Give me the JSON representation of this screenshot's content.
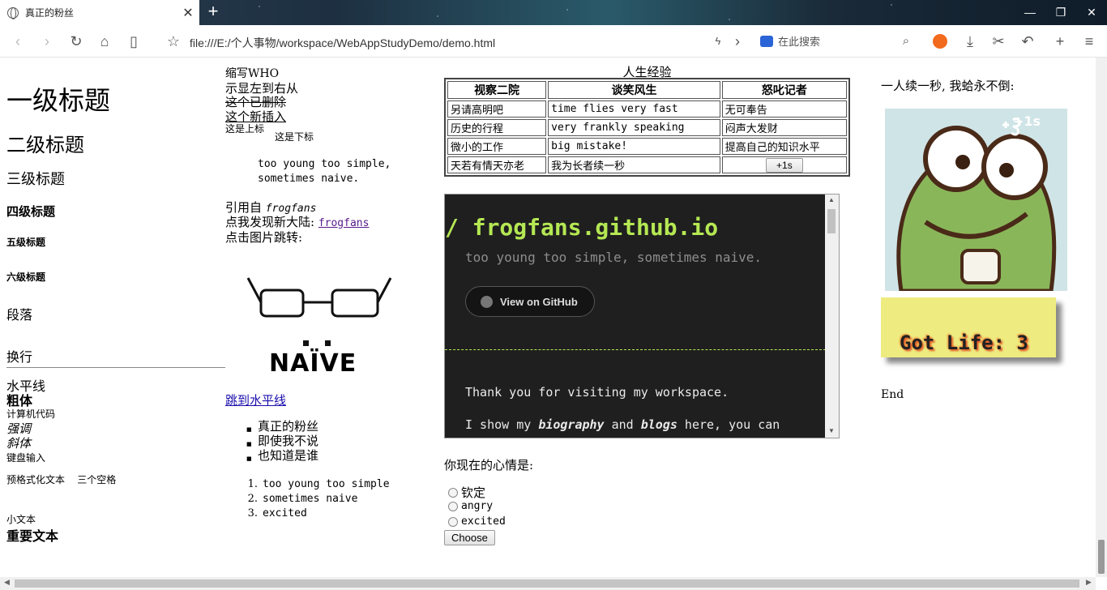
{
  "browser": {
    "tab_title": "真正的粉丝",
    "tab_close": "✕",
    "new_tab": "+",
    "url": "file:///E:/个人事物/workspace/WebAppStudyDemo/demo.html",
    "search_placeholder": "在此搜索",
    "window_controls": [
      "—",
      "❐",
      "✕"
    ]
  },
  "col1": {
    "h1": "一级标题",
    "h2": "二级标题",
    "h3": "三级标题",
    "h4": "四级标题",
    "h5": "五级标题",
    "h6": "六级标题",
    "paragraph": "段落",
    "line_break": "换行",
    "hr_text": "水平线",
    "bold": "粗体",
    "code": "计算机代码",
    "em": "强调",
    "italic": "斜体",
    "kbd": "键盘输入",
    "pre": "预格式化文本    三个空格",
    "small": "小文本",
    "strong": "重要文本"
  },
  "col2": {
    "abbr": "缩写WHO",
    "bdo": "示显左到右从",
    "del": "这个已删除",
    "ins": "这个新插入",
    "sup": "这是上标",
    "sub": "这是下标",
    "blockquote_1": "too young too simple,",
    "blockquote_2": "sometimes naive.",
    "cite_prefix": "引用自 ",
    "cite": "frogfans",
    "link_prefix": "点我发现新大陆: ",
    "link": "frogfans",
    "img_link_text": "点击图片跳转:",
    "naive_word": "NAÏVE",
    "jump_link": "跳到水平线",
    "ul": [
      "真正的粉丝",
      "即使我不说",
      "也知道是谁"
    ],
    "ol": [
      "too young too simple",
      "sometimes naive",
      "excited"
    ]
  },
  "col3": {
    "caption": "人生经验",
    "headers": [
      "视察二院",
      "谈笑风生",
      "怒叱记者"
    ],
    "rows": [
      [
        "另请高明吧",
        "time flies very fast",
        "无可奉告"
      ],
      [
        "历史的行程",
        "very frankly speaking",
        "闷声大发财"
      ],
      [
        "微小的工作",
        "big mistake!",
        "提高自己的知识水平"
      ],
      [
        "天若有情天亦老",
        "我为长者续一秒",
        "+1s"
      ]
    ],
    "iframe": {
      "heading": "/ frogfans.github.io",
      "subtitle": "too young too simple, sometimes naive.",
      "github_button": "View on GitHub",
      "text1": "Thank you for visiting my workspace.",
      "text2_a": "I show my ",
      "text2_b": "biography",
      "text2_c": " and ",
      "text2_d": "blogs",
      "text2_e": " here, you can"
    },
    "mood_question": "你现在的心情是:",
    "options": [
      "钦定",
      "angry",
      "excited"
    ],
    "choose_button": "Choose"
  },
  "col4": {
    "slogan": "一人续一秒, 我蛤永不倒:",
    "frog_badge": "+1s",
    "life_text": "Got Life: 3",
    "end": "End"
  }
}
